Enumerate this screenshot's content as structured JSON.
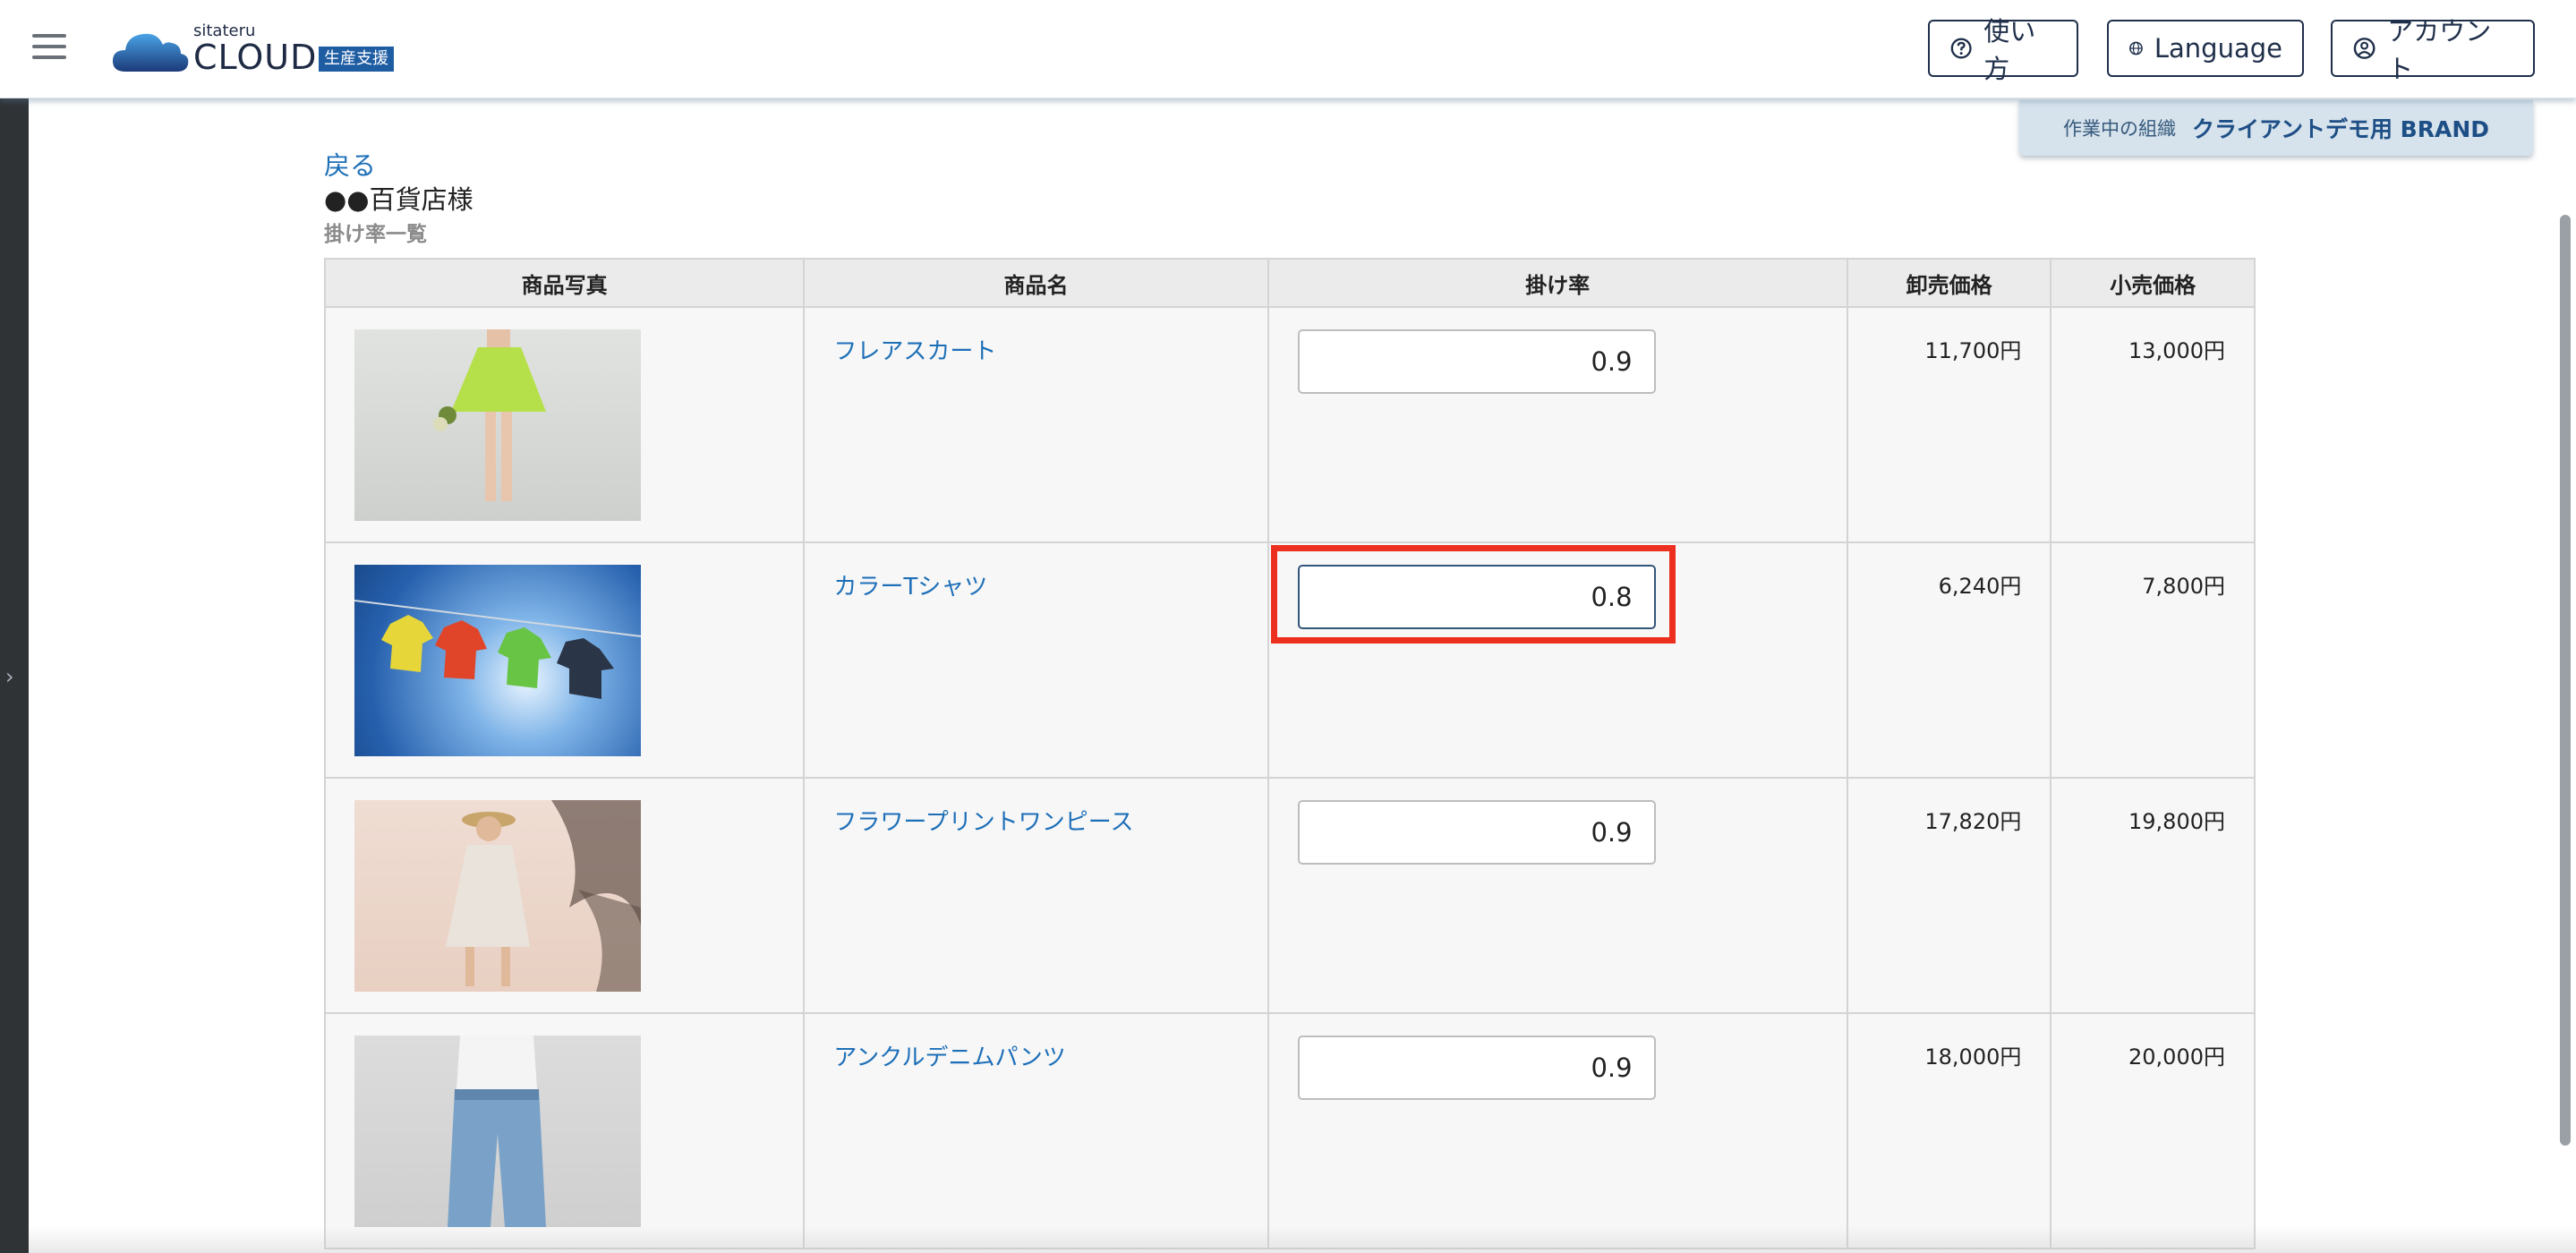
{
  "header": {
    "logo_small": "sitateru",
    "logo_big": "CLOUD",
    "logo_badge": "生産支援",
    "help_label": "使い方",
    "language_label": "Language",
    "account_label": "アカウント"
  },
  "org": {
    "label": "作業中の組織",
    "name": "クライアントデモ用 BRAND"
  },
  "page": {
    "back_label": "戻る",
    "store_name": "●●百貨店様",
    "subtitle": "掛け率一覧"
  },
  "table": {
    "headers": [
      "商品写真",
      "商品名",
      "掛け率",
      "卸売価格",
      "小売価格"
    ],
    "rows": [
      {
        "name": "フレアスカート",
        "rate": "0.9",
        "wholesale": "11,700円",
        "retail": "13,000円"
      },
      {
        "name": "カラーTシャツ",
        "rate": "0.8",
        "wholesale": "6,240円",
        "retail": "7,800円"
      },
      {
        "name": "フラワープリントワンピース",
        "rate": "0.9",
        "wholesale": "17,820円",
        "retail": "19,800円"
      },
      {
        "name": "アンクルデニムパンツ",
        "rate": "0.9",
        "wholesale": "18,000円",
        "retail": "20,000円"
      }
    ]
  },
  "icons": {
    "menu": "hamburger-icon",
    "help": "question-circle-icon",
    "language": "globe-icon",
    "account": "user-circle-icon",
    "sidebar": "chevron-right-icon"
  },
  "colors": {
    "link": "#1d6fb8",
    "highlight": "#ec2f1e",
    "brand": "#1f5da3"
  }
}
